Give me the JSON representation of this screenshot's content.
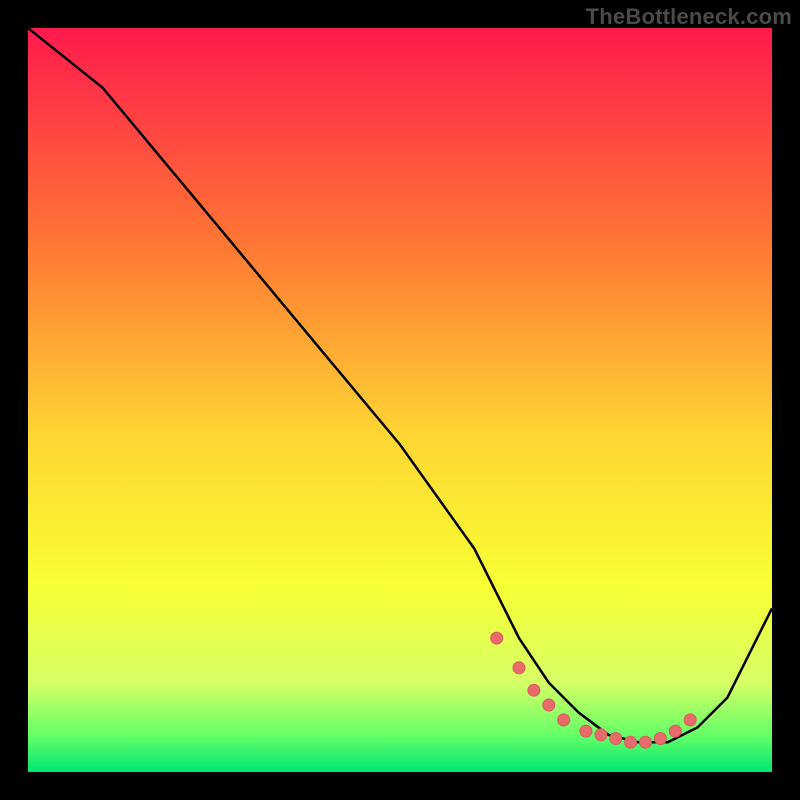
{
  "watermark": "TheBottleneck.com",
  "colors": {
    "black": "#000000",
    "curve": "#000000",
    "marker_fill": "#e86a6a",
    "marker_stroke": "#d85a5a",
    "grad_top": "#ff1a4d",
    "grad_mid1": "#ff7a33",
    "grad_mid2": "#ffd633",
    "grad_mid3": "#f7ff33",
    "grad_low": "#d6ff66",
    "grad_green1": "#66ff66",
    "grad_green2": "#00e673"
  },
  "chart_data": {
    "type": "line",
    "title": "",
    "xlabel": "",
    "ylabel": "",
    "xlim": [
      0,
      100
    ],
    "ylim": [
      0,
      100
    ],
    "series": [
      {
        "name": "curve",
        "x": [
          0,
          5,
          10,
          20,
          30,
          40,
          50,
          60,
          63,
          66,
          70,
          74,
          78,
          82,
          86,
          90,
          94,
          100
        ],
        "y": [
          100,
          96,
          92,
          80,
          68,
          56,
          44,
          30,
          24,
          18,
          12,
          8,
          5,
          4,
          4,
          6,
          10,
          22
        ]
      }
    ],
    "markers": {
      "name": "highlight-points",
      "x": [
        63,
        66,
        68,
        70,
        72,
        75,
        77,
        79,
        81,
        83,
        85,
        87,
        89
      ],
      "y": [
        18,
        14,
        11,
        9,
        7,
        5.5,
        5,
        4.5,
        4,
        4,
        4.5,
        5.5,
        7
      ]
    }
  }
}
